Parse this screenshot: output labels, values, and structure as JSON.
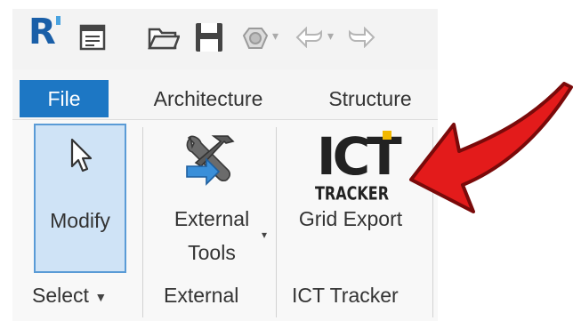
{
  "quick_access": {
    "app_logo": "R",
    "icons": [
      "revit-logo-icon",
      "project-browser-icon",
      "open-folder-icon",
      "save-icon",
      "sync-icon",
      "undo-icon",
      "redo-icon"
    ]
  },
  "tabs": [
    {
      "label": "File",
      "active": true
    },
    {
      "label": "Architecture",
      "active": false
    },
    {
      "label": "Structure",
      "active": false
    }
  ],
  "ribbon": {
    "modify": {
      "label": "Modify",
      "panel_label": "Select",
      "icon": "cursor-arrow-icon"
    },
    "external_tools": {
      "label_line1": "External",
      "label_line2": "Tools",
      "panel_label": "External",
      "icon": "tools-icon"
    },
    "grid_export": {
      "label": "Grid Export",
      "panel_label": "ICT Tracker",
      "logo_main": "ICT",
      "logo_sub": "TRACKER",
      "icon": "ict-tracker-logo-icon"
    }
  },
  "annotation": {
    "icon": "red-arrow-icon",
    "color": "#e31b1b"
  },
  "colors": {
    "file_tab": "#1d77c4",
    "modify_bg": "#cfe3f6",
    "modify_border": "#5a9bd6",
    "ict_accent": "#f2b800"
  }
}
